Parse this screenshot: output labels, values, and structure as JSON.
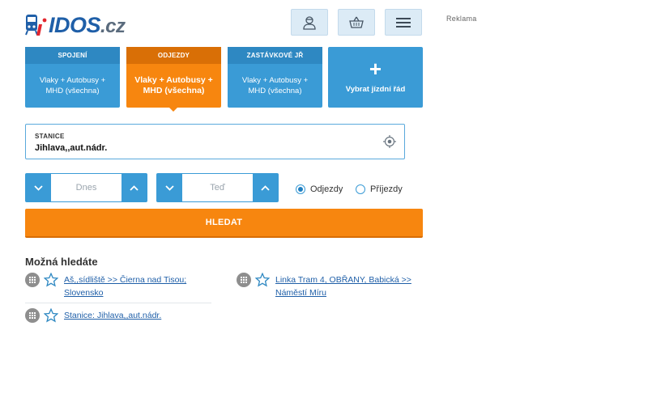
{
  "logo": {
    "brand": "IDOS",
    "tld": ".cz"
  },
  "header": {
    "buttons": [
      {
        "icon": "user-icon"
      },
      {
        "icon": "basket-icon"
      },
      {
        "icon": "hamburger-menu-icon"
      }
    ],
    "ad_label": "Reklama"
  },
  "tiles": [
    {
      "title": "SPOJENÍ",
      "subtitle": "Vlaky + Autobusy + MHD (všechna)",
      "active": false
    },
    {
      "title": "ODJEZDY",
      "subtitle": "Vlaky + Autobusy + MHD (všechna)",
      "active": true
    },
    {
      "title": "ZASTÁVKOVÉ JŘ",
      "subtitle": "Vlaky + Autobusy + MHD (všechna)",
      "active": false
    }
  ],
  "select_timetable": {
    "plus": "+",
    "label": "Vybrat jízdní řád"
  },
  "station": {
    "label": "STANICE",
    "value": "Jihlava,,aut.nádr."
  },
  "date_picker": {
    "value": "Dnes"
  },
  "time_picker": {
    "value": "Teď"
  },
  "direction": {
    "options": [
      {
        "label": "Odjezdy",
        "selected": true
      },
      {
        "label": "Příjezdy",
        "selected": false
      }
    ]
  },
  "search_button": {
    "label": "HLEDAT"
  },
  "suggestions": {
    "title": "Možná hledáte",
    "items": [
      {
        "text": "Aš,,sídliště >> Čierna nad Tisou; Slovensko"
      },
      {
        "text": "Linka Tram 4, OBŘANY, Babická >> Náměstí Míru"
      },
      {
        "text": "Stanice: Jihlava,,aut.nádr."
      }
    ]
  },
  "colors": {
    "brand_blue": "#1f5fa8",
    "tile_blue": "#3a9bd6",
    "accent_orange": "#f7860f",
    "logo_red": "#e3262e"
  }
}
